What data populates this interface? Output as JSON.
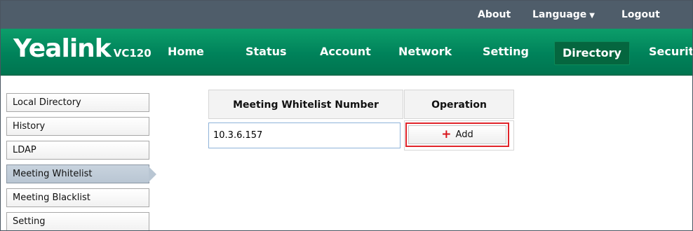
{
  "topbar": {
    "about": "About",
    "language": "Language",
    "logout": "Logout"
  },
  "brand": {
    "name": "Yealink",
    "model": "VC120"
  },
  "nav": {
    "home": "Home",
    "status": "Status",
    "account": "Account",
    "network": "Network",
    "setting": "Setting",
    "directory": "Directory",
    "security": "Security",
    "active": "Directory"
  },
  "sidebar": {
    "items": [
      {
        "label": "Local Directory"
      },
      {
        "label": "History"
      },
      {
        "label": "LDAP"
      },
      {
        "label": "Meeting Whitelist"
      },
      {
        "label": "Meeting Blacklist"
      },
      {
        "label": "Setting"
      }
    ],
    "active": "Meeting Whitelist"
  },
  "whitelist": {
    "col_number": "Meeting Whitelist Number",
    "col_operation": "Operation",
    "input_value": "10.3.6.157",
    "add_label": "Add"
  },
  "icons": {
    "language_caret": "chevron-down-icon",
    "add": "plus-icon",
    "active_indicator": "arrow-right-icon"
  },
  "colors": {
    "topbar": "#4f5d6a",
    "nav_green": "#00825a",
    "nav_active": "#05663f",
    "highlight_red": "#e0242a",
    "sidebar_active": "#b9c6d3"
  }
}
